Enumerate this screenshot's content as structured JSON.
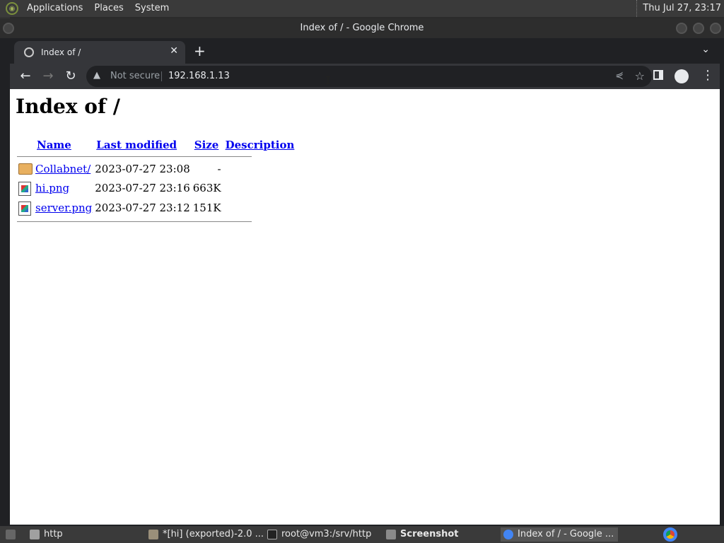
{
  "top_panel": {
    "menus": [
      "Applications",
      "Places",
      "System"
    ],
    "clock": "Thu Jul 27, 23:17"
  },
  "window": {
    "title": "Index of / - Google Chrome"
  },
  "browser": {
    "tab_title": "Index of /",
    "new_tab": "+",
    "security_label": "Not secure",
    "url": "192.168.1.13"
  },
  "page": {
    "heading": "Index of /",
    "columns": [
      "Name",
      "Last modified",
      "Size",
      "Description"
    ],
    "rows": [
      {
        "name": "Collabnet/",
        "modified": "2023-07-27 23:08",
        "size": "-",
        "description": "",
        "icon": "folder-icon"
      },
      {
        "name": "hi.png",
        "modified": "2023-07-27 23:16",
        "size": "663K",
        "description": "",
        "icon": "image-icon"
      },
      {
        "name": "server.png",
        "modified": "2023-07-27 23:12",
        "size": "151K",
        "description": "",
        "icon": "image-icon"
      }
    ]
  },
  "taskbar": {
    "tasks": [
      {
        "label": "http",
        "icon": "folder-icon"
      },
      {
        "label": "*[hi] (exported)-2.0 ...",
        "icon": "gimp-icon"
      },
      {
        "label": "root@vm3:/srv/http",
        "icon": "terminal-icon"
      },
      {
        "label": "Screenshot",
        "icon": "screenshot-icon"
      },
      {
        "label": "Index of / - Google ...",
        "icon": "chrome-icon"
      }
    ]
  }
}
